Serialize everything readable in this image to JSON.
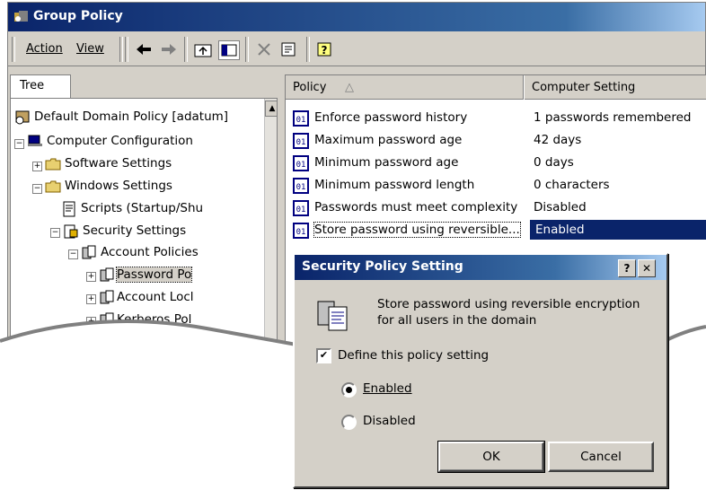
{
  "window": {
    "title": "Group Policy"
  },
  "toolbar": {
    "action_label": "Action",
    "view_label": "View"
  },
  "tree": {
    "tab_label": "Tree",
    "nodes": [
      {
        "label": "Default Domain Policy [adatum]"
      },
      {
        "label": "Computer Configuration"
      },
      {
        "label": "Software Settings"
      },
      {
        "label": "Windows Settings"
      },
      {
        "label": "Scripts (Startup/Shu"
      },
      {
        "label": "Security Settings"
      },
      {
        "label": "Account Policies"
      },
      {
        "label": "Password Po"
      },
      {
        "label": "Account Locl"
      },
      {
        "label": "Kerberos Pol"
      }
    ]
  },
  "list": {
    "columns": {
      "policy": "Policy",
      "setting": "Computer Setting"
    },
    "rows": [
      {
        "policy": "Enforce password history",
        "setting": "1 passwords remembered"
      },
      {
        "policy": "Maximum password age",
        "setting": "42 days"
      },
      {
        "policy": "Minimum password age",
        "setting": "0 days"
      },
      {
        "policy": "Minimum password length",
        "setting": "0 characters"
      },
      {
        "policy": "Passwords must meet complexity",
        "setting": "Disabled"
      },
      {
        "policy": "Store password using reversible...",
        "setting": "Enabled",
        "selected": true
      }
    ]
  },
  "dialog": {
    "title": "Security Policy Setting",
    "help_btn": "?",
    "close_btn": "✕",
    "description": "Store password using reversible encryption for all users in the domain",
    "define_label": "Define this policy setting",
    "define_checked": true,
    "enabled_label": "Enabled",
    "disabled_label": "Disabled",
    "selected_option": "Enabled",
    "ok_label": "OK",
    "cancel_label": "Cancel"
  }
}
